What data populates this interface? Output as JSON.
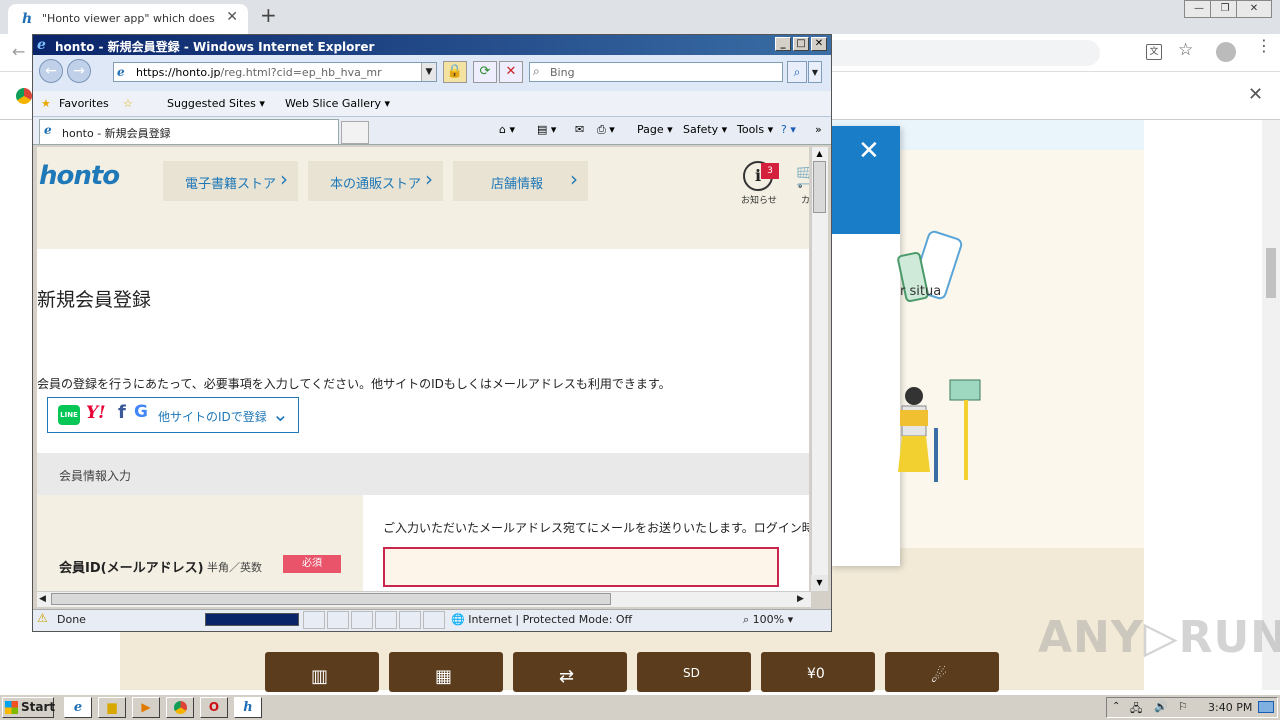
{
  "chrome": {
    "tab_title": "\"Honto viewer app\" which does not r",
    "new_tab": "+",
    "translate_label": "文"
  },
  "background_page": {
    "situa_text": "r situa",
    "bottom_buttons": [
      "▥",
      "▦",
      "⇄",
      "SD",
      "¥0",
      "☄"
    ],
    "watermark": "ANY▷RUN"
  },
  "ie": {
    "title": "honto - 新規会員登録 - Windows Internet Explorer",
    "address": {
      "host": "https://honto.jp",
      "path": "/reg.html?cid=ep_hb_hva_mr"
    },
    "search_placeholder": "Bing",
    "favorites": {
      "favorites_label": "Favorites",
      "suggested": "Suggested Sites ▾",
      "web_slice": "Web Slice Gallery ▾"
    },
    "tab_title": "honto - 新規会員登録",
    "commands": {
      "page": "Page ▾",
      "safety": "Safety ▾",
      "tools": "Tools ▾"
    },
    "status": {
      "text": "Done",
      "zone": "Internet | Protected Mode: Off",
      "zoom": "100%"
    }
  },
  "honto": {
    "logo": "honto",
    "nav": [
      {
        "label": "電子書籍ストア"
      },
      {
        "label": "本の通販ストア"
      },
      {
        "label": "店舗情報"
      }
    ],
    "notice_label": "お知らせ",
    "notice_count": "3",
    "cart_label": "カ",
    "registration_title": "新規会員登録",
    "registration_desc": "会員の登録を行うにあたって、必要事項を入力してください。他サイトのIDもしくはメールアドレスも利用できます。",
    "sns": {
      "line": "LINE",
      "yahoo": "Y!",
      "facebook": "f",
      "google": "G",
      "label": "他サイトのIDで登録"
    },
    "section_title": "会員情報入力",
    "member_id_label": "会員ID(メールアドレス)",
    "member_id_hint": "半角／英数",
    "required_badge": "必須",
    "email_desc": "ご入力いただいたメールアドレス宛てにメールをお送りいたします。ログイン時に使用して",
    "email_value": ""
  },
  "taskbar": {
    "start": "Start",
    "clock": "3:40 PM"
  }
}
